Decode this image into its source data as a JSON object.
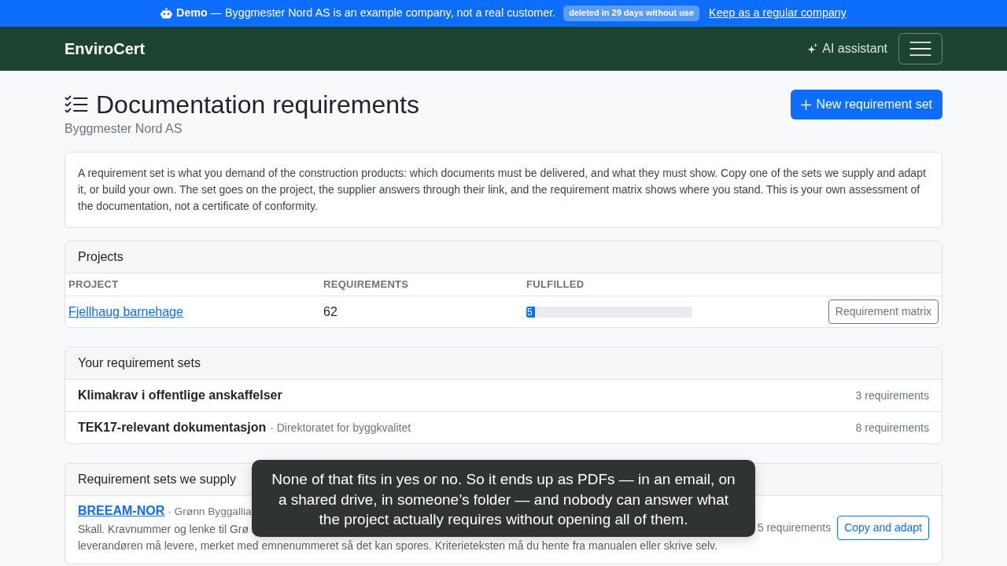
{
  "demo_banner": {
    "message": "**Demo** — Byggmester Nord AS is an example company, not a real customer.",
    "badge": "deleted in 29 days without use",
    "link": "Keep as a regular company"
  },
  "navbar": {
    "brand": "EnviroCert",
    "ai_button": "AI assistant"
  },
  "page_header": {
    "title": "Documentation requirements",
    "subtitle": "Byggmester Nord AS",
    "primary_button": "New requirement set"
  },
  "intro": "A requirement set is what you demand of the construction products: which documents must be delivered, and what they must show. Copy one of the sets we supply and adapt it, or build your own. The set goes on the project, the supplier answers through their link, and the requirement matrix shows where you stand. This is your own assessment of the documentation, not a certificate of conformity.",
  "projects": {
    "title": "Projects",
    "columns": [
      "PROJECT",
      "REQUIREMENTS",
      "FULFILLED"
    ],
    "rows": [
      {
        "project": "Fjellhaug barnehage",
        "requirements": "62",
        "fulfilled": {
          "level": 0.05,
          "label": "5"
        },
        "action": "Requirement matrix"
      }
    ]
  },
  "own_sets": {
    "title": "Your requirement sets",
    "items": [
      {
        "name": "Klimakrav i offentlige anskaffelser",
        "count": "3 requirements"
      },
      {
        "name": "TEK17-relevant dokumentasjon",
        "source": "· Direktoratet for byggkvalitet",
        "count": "8 requirements"
      }
    ]
  },
  "supplied_sets": {
    "title": "Requirement sets we supply",
    "items": [
      {
        "name": "BREEAM-NOR",
        "source": "· Grønn Byggallia",
        "description_lines": [
          "Skall. Kravnummer og lenke til Grø",
          "leverandøren må levere, merket med emnenummeret så det kan spores. Kriterieteksten må du hente fra manualen eller skrive selv."
        ],
        "count": "5 requirements",
        "action": "Copy and adapt"
      }
    ]
  },
  "caption": "None of that fits in yes or no. So it ends up as PDFs — in an email, on a shared drive, in someone’s folder — and nobody can answer what the project actually requires without opening all of them."
}
